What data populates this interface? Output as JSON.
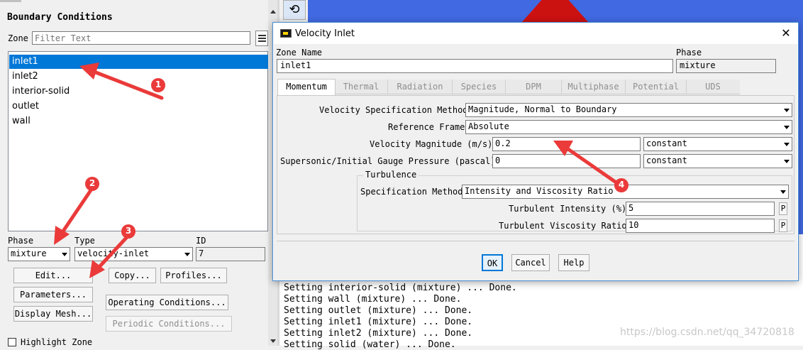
{
  "boundary_panel": {
    "title": "Boundary Conditions",
    "zone_label": "Zone",
    "filter_placeholder": "Filter Text",
    "zones": [
      "inlet1",
      "inlet2",
      "interior-solid",
      "outlet",
      "wall"
    ],
    "selected_zone_index": 0,
    "phase_label": "Phase",
    "phase_value": "mixture",
    "type_label": "Type",
    "type_value": "velocity-inlet",
    "id_label": "ID",
    "id_value": "7",
    "buttons": {
      "edit": "Edit...",
      "copy": "Copy...",
      "profiles": "Profiles...",
      "parameters": "Parameters...",
      "operating_conditions": "Operating Conditions...",
      "display_mesh": "Display Mesh...",
      "periodic_conditions": "Periodic Conditions..."
    },
    "highlight_zone_label": "Highlight Zone"
  },
  "dialog": {
    "title": "Velocity Inlet",
    "zone_name_label": "Zone Name",
    "zone_name_value": "inlet1",
    "phase_label": "Phase",
    "phase_value": "mixture",
    "tabs": [
      "Momentum",
      "Thermal",
      "Radiation",
      "Species",
      "DPM",
      "Multiphase",
      "Potential",
      "UDS"
    ],
    "active_tab": "Momentum",
    "velocity_spec_label": "Velocity Specification Method",
    "velocity_spec_value": "Magnitude, Normal to Boundary",
    "reference_frame_label": "Reference Frame",
    "reference_frame_value": "Absolute",
    "velocity_magnitude_label": "Velocity Magnitude (m/s)",
    "velocity_magnitude_value": "0.2",
    "velocity_magnitude_profile": "constant",
    "gauge_pressure_label": "Supersonic/Initial Gauge Pressure (pascal)",
    "gauge_pressure_value": "0",
    "gauge_pressure_profile": "constant",
    "turbulence_group_label": "Turbulence",
    "turb_spec_label": "Specification Method",
    "turb_spec_value": "Intensity and Viscosity Ratio",
    "turb_intensity_label": "Turbulent Intensity (%)",
    "turb_intensity_value": "5",
    "turb_viscosity_label": "Turbulent Viscosity Ratio",
    "turb_viscosity_value": "10",
    "param_button": "P",
    "ok_label": "OK",
    "cancel_label": "Cancel",
    "help_label": "Help"
  },
  "console": {
    "lines": [
      "Setting interior-solid (mixture) ... Done.",
      "Setting wall (mixture) ... Done.",
      "Setting outlet (mixture) ... Done.",
      "Setting inlet1 (mixture) ... Done.",
      "Setting inlet2 (mixture) ... Done.",
      "Setting solid (water) ... Done."
    ]
  },
  "annotations": [
    "1",
    "2",
    "3",
    "4"
  ],
  "watermark": "https://blog.csdn.net/qq_34720818",
  "colors": {
    "selection": "#0078d7",
    "annotation_red": "#ea3a3a",
    "viewport_blue": "#4169e1",
    "mesh_red": "#cc1111",
    "ok_border": "#0078d7"
  }
}
